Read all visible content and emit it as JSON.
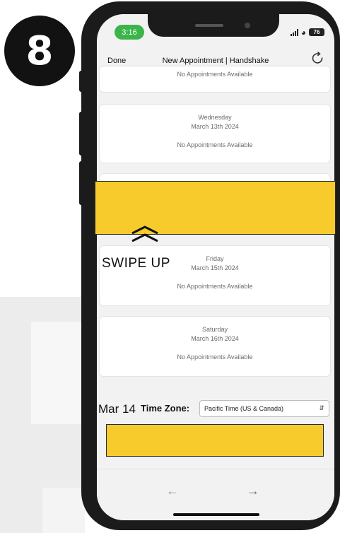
{
  "step_number": "8",
  "status_bar": {
    "time": "3:16",
    "battery": "76"
  },
  "nav": {
    "done_label": "Done",
    "title": "New Appointment | Handshake"
  },
  "days": [
    {
      "name": "",
      "date": "",
      "status": "No Appointments Available"
    },
    {
      "name": "Wednesday",
      "date": "March 13th 2024",
      "status": "No Appointments Available"
    },
    {
      "name": "Friday",
      "date": "March 15th 2024",
      "status": "No Appointments Available"
    },
    {
      "name": "Saturday",
      "date": "March 16th 2024",
      "status": "No Appointments Available"
    }
  ],
  "overlay": {
    "swipe_label": "SWIPE UP",
    "date_label": "Mar 14",
    "highlight_color": "#f7cb2b"
  },
  "timezone": {
    "label": "Time Zone:",
    "selected": "Pacific Time (US & Canada)"
  },
  "icons": {
    "refresh": "refresh-icon",
    "back": "arrow-left-icon",
    "forward": "arrow-right-icon",
    "swipe": "double-chevron-up-icon"
  }
}
